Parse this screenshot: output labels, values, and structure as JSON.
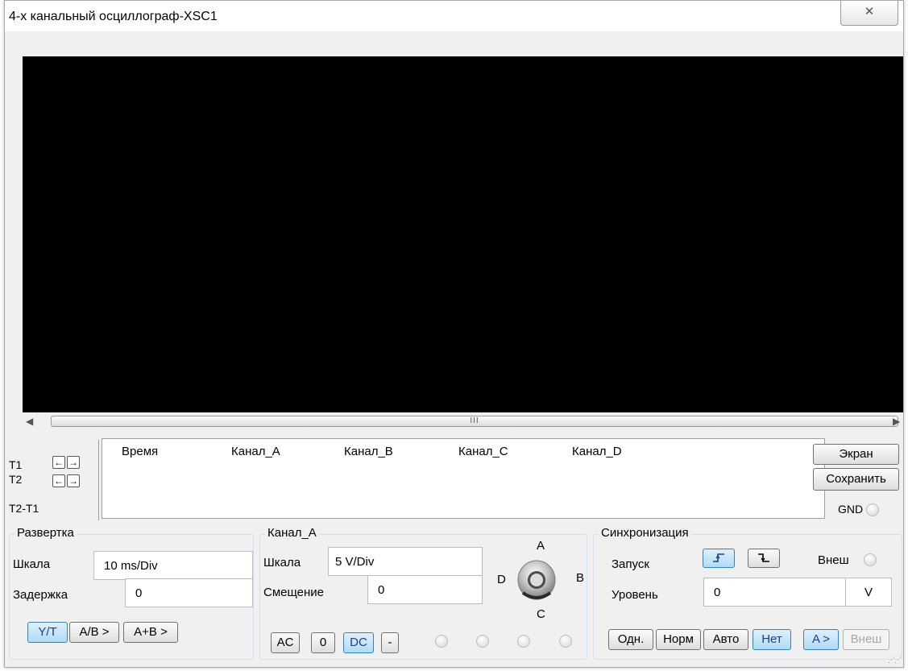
{
  "window": {
    "title": "4-х канальный осциллограф-XSC1",
    "close_glyph": "⌧"
  },
  "scrollbar": {
    "left_arrow": "◀",
    "right_arrow": "▶",
    "thumb_grip": "III"
  },
  "cursor_controls": {
    "t1_label": "T1",
    "t2_label": "T2",
    "t2t1_label": "T2-T1",
    "left_arrow": "🡸",
    "right_arrow": "🡺"
  },
  "readout": {
    "headers": [
      "Время",
      "Канал_A",
      "Канал_B",
      "Канал_C",
      "Канал_D"
    ]
  },
  "side_buttons": {
    "screen": "Экран",
    "save": "Сохранить",
    "gnd": "GND"
  },
  "timebase": {
    "title": "Развертка",
    "scale_label": "Шкала",
    "scale_value": "10 ms/Div",
    "delay_label": "Задержка",
    "delay_value": "0",
    "modes": [
      "Y/T",
      "A/B >",
      "A+B >"
    ],
    "active_mode": "Y/T"
  },
  "channel": {
    "title": "Канал_A",
    "scale_label": "Шкала",
    "scale_value": "5  V/Div",
    "offset_label": "Смещение",
    "offset_value": "0",
    "coupling": [
      "AC",
      "0",
      "DC",
      "-"
    ],
    "active_coupling": "DC",
    "selector": {
      "a": "A",
      "b": "B",
      "c": "C",
      "d": "D",
      "selected": "A"
    }
  },
  "trigger": {
    "title": "Синхронизация",
    "edge_label": "Запуск",
    "edge_rising": "⎍",
    "edge_falling": "⎍",
    "ext_label": "Внеш",
    "level_label": "Уровень",
    "level_value": "0",
    "level_unit": "V",
    "modes": [
      "Одн.",
      "Норм",
      "Авто",
      "Нет"
    ],
    "active_mode": "Нет",
    "source_a": "A >",
    "source_ext": "Внеш"
  },
  "colors": {
    "screen": "#000000",
    "active_button": "#aedcf6",
    "panel": "#f0f0f0"
  }
}
